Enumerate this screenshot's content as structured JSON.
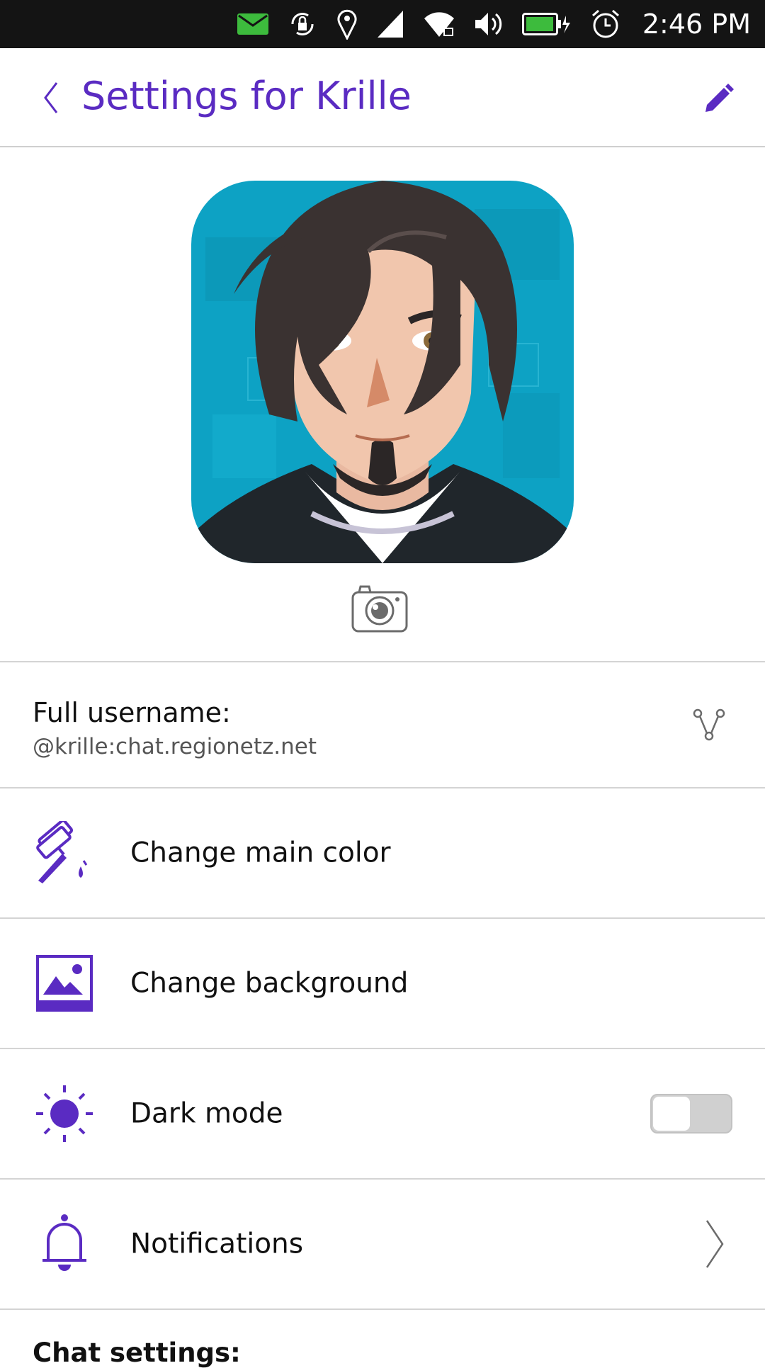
{
  "status_bar": {
    "time": "2:46 PM",
    "icons": [
      "mail-icon",
      "rotation-lock-icon",
      "location-icon",
      "cell-signal-icon",
      "wifi-icon",
      "volume-icon",
      "battery-charging-icon",
      "alarm-icon"
    ],
    "mail_color": "#3dbb3d",
    "battery_color": "#3dbb3d"
  },
  "header": {
    "title": "Settings for Krille",
    "back_icon": "back-chevron-icon",
    "edit_icon": "pencil-icon"
  },
  "profile": {
    "avatar": "avatar-image",
    "camera_icon": "camera-icon"
  },
  "account": {
    "label": "Full username:",
    "value": "@krille:chat.regionetz.net",
    "share_icon": "share-icon"
  },
  "settings": [
    {
      "label": "Change main color",
      "icon": "paint-roller-icon"
    },
    {
      "label": "Change background",
      "icon": "image-icon"
    },
    {
      "label": "Dark mode",
      "icon": "sun-icon",
      "toggle_on": false
    },
    {
      "label": "Notifications",
      "icon": "bell-icon"
    }
  ],
  "section": {
    "title": "Chat settings:"
  },
  "colors": {
    "accent": "#5a2bc2",
    "avatar_bg": "#0da2c4"
  }
}
